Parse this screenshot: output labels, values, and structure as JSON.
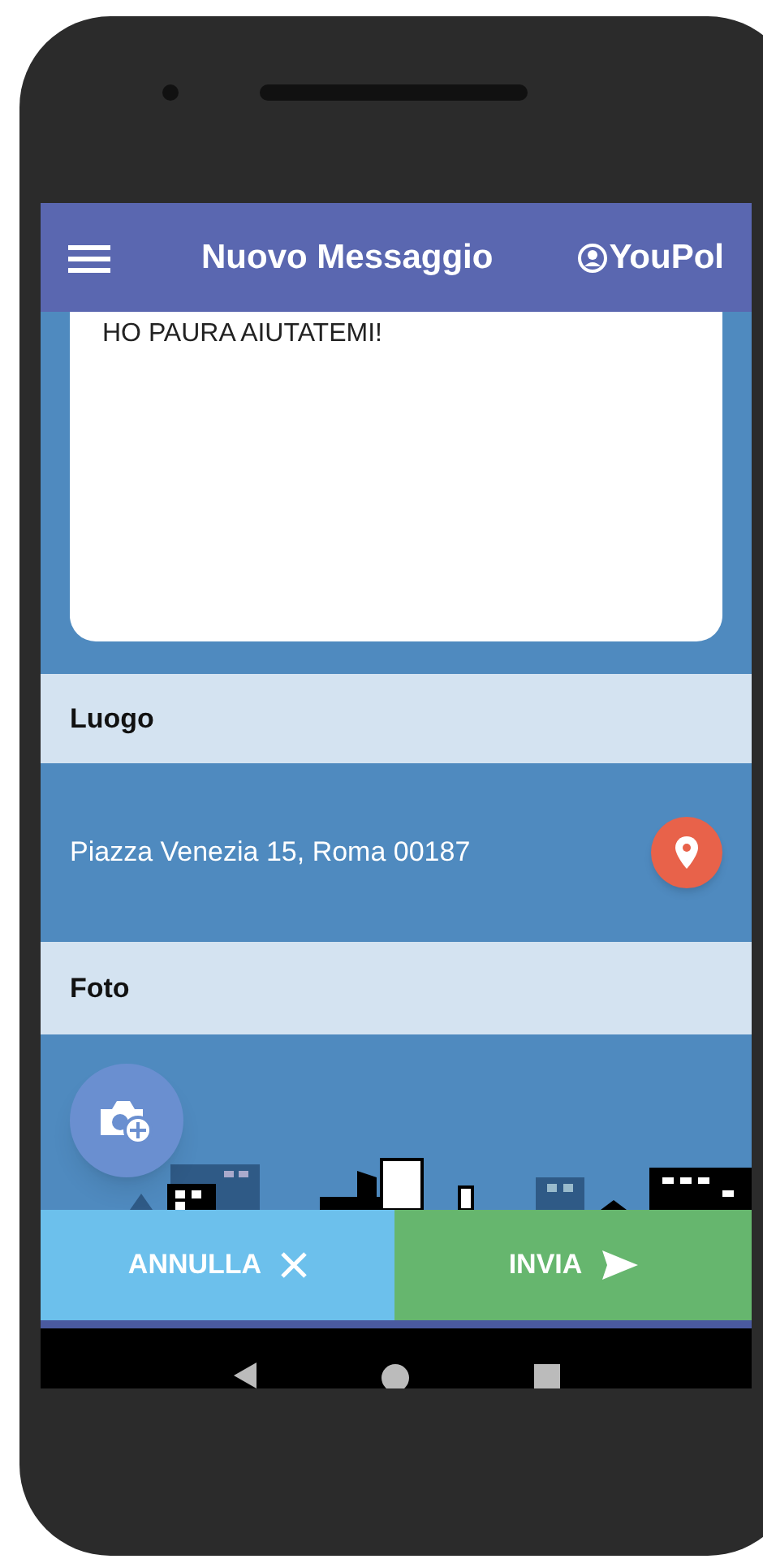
{
  "app_bar": {
    "title": "Nuovo Messaggio",
    "account": "YouPol"
  },
  "message": {
    "value": "HO PAURA AIUTATEMI!"
  },
  "place": {
    "heading": "Luogo",
    "address": "Piazza Venezia 15, Roma 00187"
  },
  "photo": {
    "heading": "Foto"
  },
  "buttons": [
    {
      "kind": "cancel",
      "label": "ANNULLA"
    },
    {
      "kind": "send",
      "label": "INVIA"
    }
  ]
}
